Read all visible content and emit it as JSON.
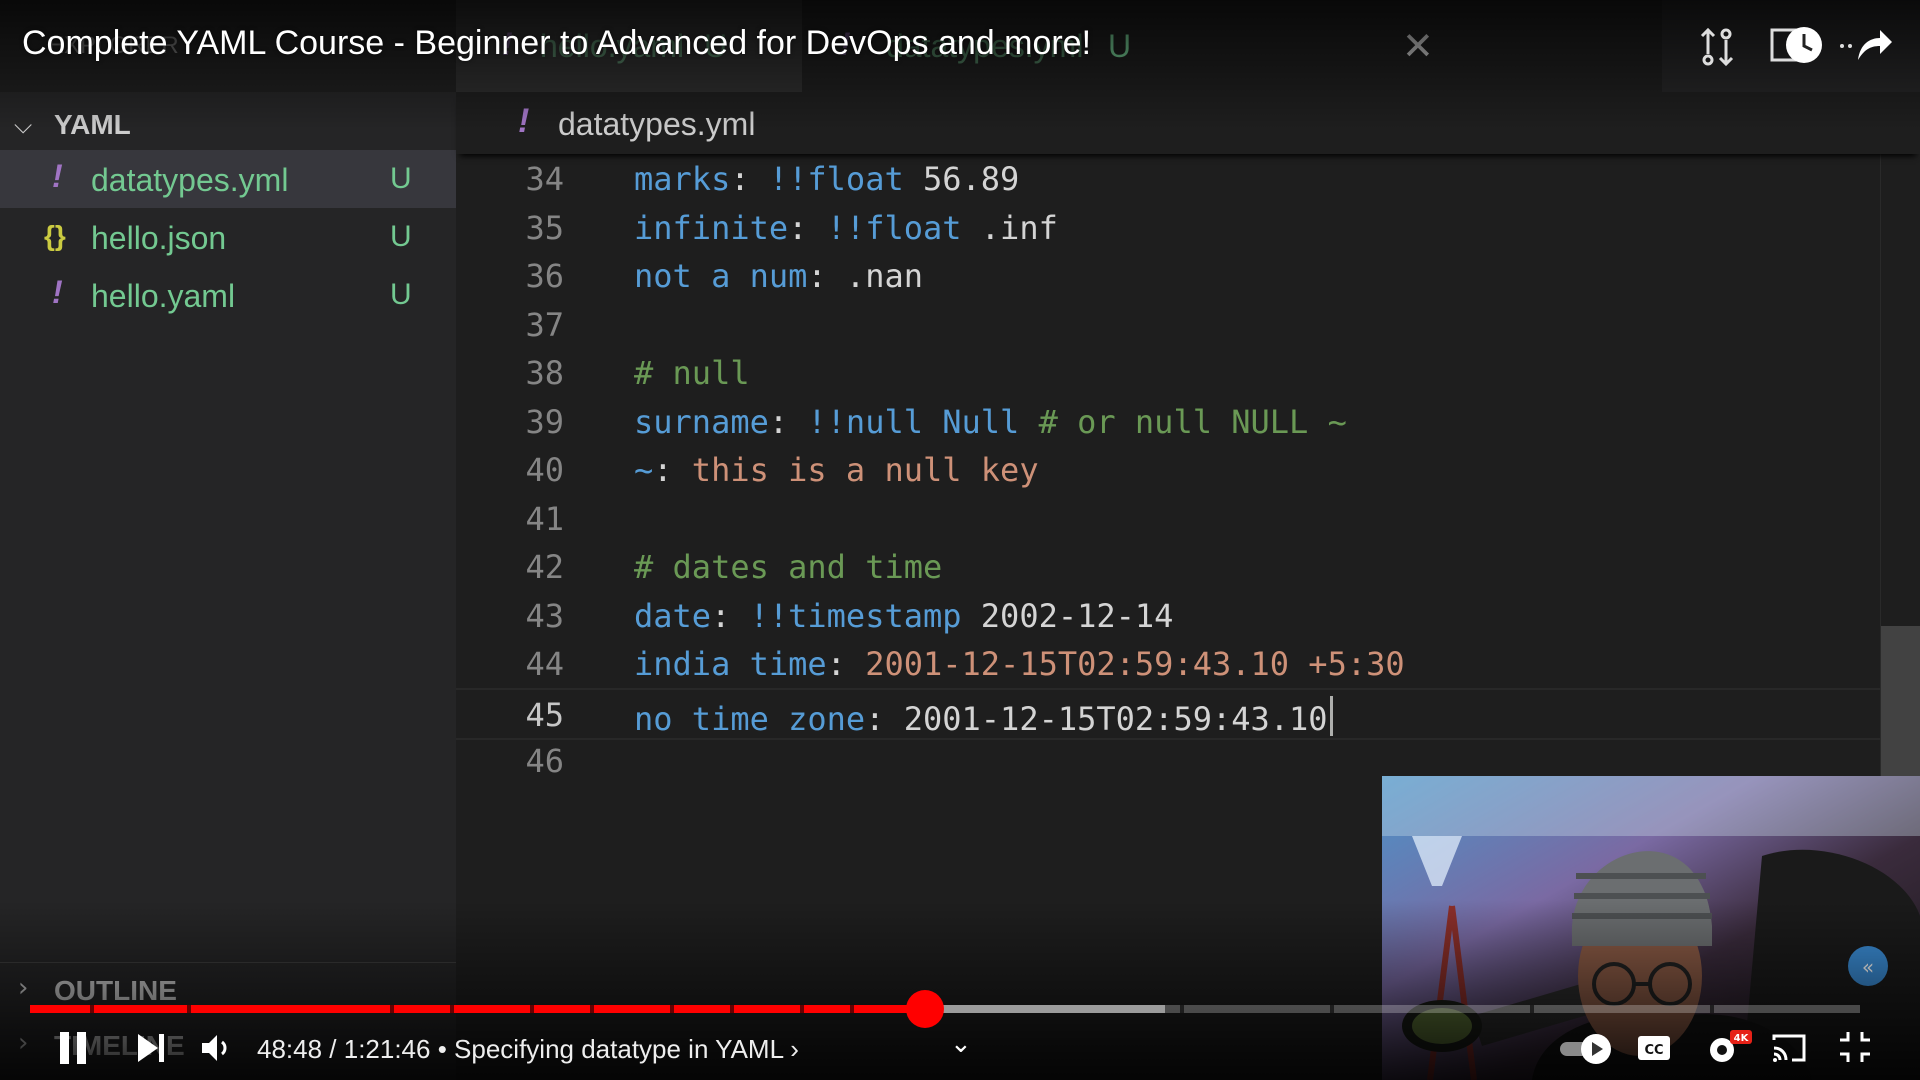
{
  "sidebar": {
    "header_title": "EXPLORER",
    "section_yaml": {
      "chevron": "⌵",
      "label": "YAML"
    },
    "files": [
      {
        "icon": "!",
        "name": "datatypes.yml",
        "badge": "U"
      },
      {
        "icon": "{}",
        "name": "hello.json",
        "badge": "U"
      },
      {
        "icon": "!",
        "name": "hello.yaml",
        "badge": "U"
      }
    ],
    "outline_label": "OUTLINE",
    "timeline_label": "TIMELINE"
  },
  "tabs": [
    {
      "icon": "!",
      "name": "hello.yaml",
      "badge": "U"
    },
    {
      "icon": "!",
      "name": "datatypes.yml",
      "badge": "U"
    }
  ],
  "breadcrumb": {
    "icon": "!",
    "file": "datatypes.yml"
  },
  "editor": {
    "lines": [
      {
        "n": "34",
        "tokens": [
          {
            "t": "marks",
            "c": "k"
          },
          {
            "t": ": ",
            "c": "p"
          },
          {
            "t": "!!float",
            "c": "t"
          },
          {
            "t": " 56.89",
            "c": "n"
          }
        ]
      },
      {
        "n": "35",
        "tokens": [
          {
            "t": "infinite",
            "c": "k"
          },
          {
            "t": ": ",
            "c": "p"
          },
          {
            "t": "!!float",
            "c": "t"
          },
          {
            "t": " .inf",
            "c": "n"
          }
        ]
      },
      {
        "n": "36",
        "tokens": [
          {
            "t": "not a num",
            "c": "k"
          },
          {
            "t": ": ",
            "c": "p"
          },
          {
            "t": ".nan",
            "c": "n"
          }
        ]
      },
      {
        "n": "37",
        "tokens": []
      },
      {
        "n": "38",
        "tokens": [
          {
            "t": "# null",
            "c": "c"
          }
        ]
      },
      {
        "n": "39",
        "tokens": [
          {
            "t": "surname",
            "c": "k"
          },
          {
            "t": ": ",
            "c": "p"
          },
          {
            "t": "!!null",
            "c": "t"
          },
          {
            "t": " Null",
            "c": "k"
          },
          {
            "t": " # or null NULL ~",
            "c": "c"
          }
        ]
      },
      {
        "n": "40",
        "tokens": [
          {
            "t": "~",
            "c": "k"
          },
          {
            "t": ": ",
            "c": "p"
          },
          {
            "t": "this is a null key",
            "c": "s"
          }
        ]
      },
      {
        "n": "41",
        "tokens": []
      },
      {
        "n": "42",
        "tokens": [
          {
            "t": "# dates and time",
            "c": "c"
          }
        ]
      },
      {
        "n": "43",
        "tokens": [
          {
            "t": "date",
            "c": "k"
          },
          {
            "t": ": ",
            "c": "p"
          },
          {
            "t": "!!timestamp",
            "c": "t"
          },
          {
            "t": " 2002-12-14",
            "c": "n"
          }
        ]
      },
      {
        "n": "44",
        "tokens": [
          {
            "t": "india time",
            "c": "k"
          },
          {
            "t": ": ",
            "c": "p"
          },
          {
            "t": "2001-12-15T02:59:43.10 +5:30",
            "c": "s"
          }
        ]
      },
      {
        "n": "45",
        "tokens": [
          {
            "t": "no time zone",
            "c": "k"
          },
          {
            "t": ": ",
            "c": "p"
          },
          {
            "t": "2001-12-15T02:59:43.10",
            "c": "n"
          }
        ],
        "current": true
      },
      {
        "n": "46",
        "tokens": []
      }
    ]
  },
  "video": {
    "title": "Complete YAML Course - Beginner to Advanced for DevOps and more!",
    "current_time": "48:48",
    "duration": "1:21:46",
    "time_text": "48:48 / 1:21:46 • Specifying datatype in YAML ›",
    "chapter": "Specifying datatype in YAML",
    "progress_fraction": 0.489,
    "buffered_fraction": 0.62,
    "quality_badge": "4K",
    "icons": {
      "pause": "pause-icon",
      "next": "next-icon",
      "volume": "volume-icon",
      "autoplay": "autoplay-toggle-icon",
      "cc": "cc-icon",
      "settings": "settings-icon",
      "cast": "cast-icon",
      "exit_fullscreen": "exit-fullscreen-icon",
      "share": "share-icon",
      "watch_later": "watch-later-icon",
      "info": "info-icon"
    }
  },
  "colors": {
    "accent_red": "#ff0000",
    "untracked_green": "#73c991",
    "yaml_purple": "#a074c4",
    "json_yellow": "#cbcb41"
  }
}
